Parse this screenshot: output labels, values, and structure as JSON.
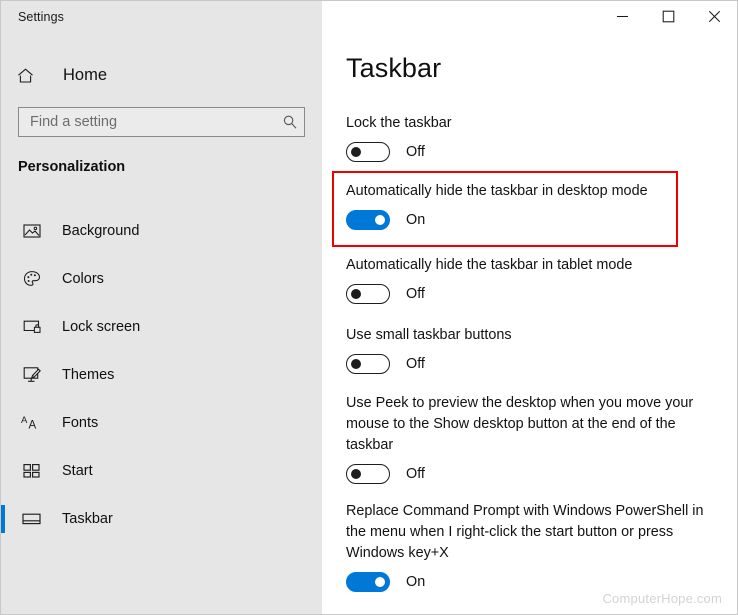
{
  "window": {
    "app_title": "Settings",
    "controls": [
      {
        "name": "minimize",
        "glyph": "minimize-icon",
        "label": "Minimize"
      },
      {
        "name": "maximize",
        "glyph": "maximize-icon",
        "label": "Maximize"
      },
      {
        "name": "close",
        "glyph": "close-icon",
        "label": "Close"
      }
    ]
  },
  "sidebar": {
    "home_label": "Home",
    "home_icon": "home-icon",
    "search": {
      "placeholder": "Find a setting",
      "value": "",
      "icon": "search-icon"
    },
    "section_heading": "Personalization",
    "items": [
      {
        "label": "Background",
        "icon": "image-icon",
        "selected": false
      },
      {
        "label": "Colors",
        "icon": "palette-icon",
        "selected": false
      },
      {
        "label": "Lock screen",
        "icon": "lock-screen-icon",
        "selected": false
      },
      {
        "label": "Themes",
        "icon": "themes-brush-icon",
        "selected": false
      },
      {
        "label": "Fonts",
        "icon": "fonts-aa-icon",
        "selected": false
      },
      {
        "label": "Start",
        "icon": "start-tiles-icon",
        "selected": false
      },
      {
        "label": "Taskbar",
        "icon": "taskbar-icon",
        "selected": true
      }
    ]
  },
  "main": {
    "page_title": "Taskbar",
    "settings": [
      {
        "label": "Lock the taskbar",
        "state": "Off",
        "on": false
      },
      {
        "label": "Automatically hide the taskbar in desktop mode",
        "state": "On",
        "on": true
      },
      {
        "label": "Automatically hide the taskbar in tablet mode",
        "state": "Off",
        "on": false
      },
      {
        "label": "Use small taskbar buttons",
        "state": "Off",
        "on": false
      },
      {
        "label": "Use Peek to preview the desktop when you move your mouse to the Show desktop button at the end of the taskbar",
        "state": "Off",
        "on": false
      },
      {
        "label": "Replace Command Prompt with Windows PowerShell in the menu when I right-click the start button or press Windows key+X",
        "state": "On",
        "on": true
      }
    ]
  },
  "annotation": {
    "highlight_color": "#f00000",
    "highlights_setting": "Automatically hide the taskbar in desktop mode"
  },
  "watermark": "ComputerHope.com",
  "colors": {
    "accent": "#0078d7",
    "sidebar_bg": "#e6e6e6",
    "panel_bg": "#ffffff",
    "annotation_red": "#f00000"
  }
}
